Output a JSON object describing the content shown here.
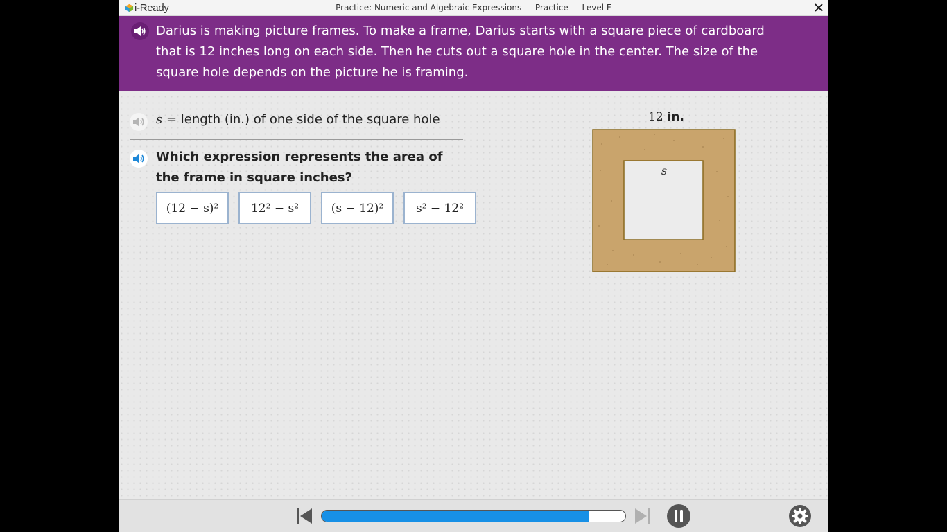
{
  "app": {
    "logo_text": "i-Ready",
    "window_title": "Practice: Numeric and Algebraic Expressions — Practice — Level F",
    "close_symbol": "✕"
  },
  "prompt": {
    "text": "Darius is making picture frames. To make a frame, Darius starts with a square piece of cardboard that is 12 inches long on each side. Then he cuts out a square hole in the center. The size of the square hole depends on the picture he is framing."
  },
  "definition": {
    "variable": "s",
    "text": " = length (in.) of one side of the square hole"
  },
  "question": {
    "text": "Which expression represents the area of the frame in square inches?"
  },
  "choices": [
    {
      "label": "(12 − s)²"
    },
    {
      "label": "12² − s²"
    },
    {
      "label": "(s − 12)²"
    },
    {
      "label": "s² − 12²"
    }
  ],
  "figure": {
    "dimension_value": "12",
    "dimension_unit": " in.",
    "hole_label": "s",
    "frame_color": "#c9a46c",
    "frame_border_color": "#8a6a1f"
  },
  "bottom_bar": {
    "progress_percent": 88,
    "accent_color": "#1790e6",
    "icons": [
      "previous-icon",
      "next-icon",
      "pause-icon",
      "gear-icon"
    ]
  }
}
